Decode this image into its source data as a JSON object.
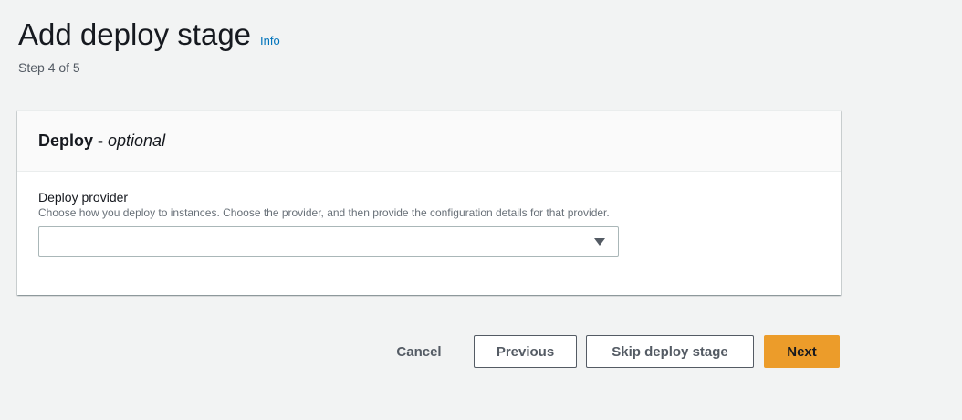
{
  "header": {
    "title": "Add deploy stage",
    "info_link": "Info",
    "step": "Step 4 of 5"
  },
  "panel": {
    "title_main": "Deploy - ",
    "title_optional": "optional",
    "field": {
      "label": "Deploy provider",
      "description": "Choose how you deploy to instances. Choose the provider, and then provide the configuration details for that provider.",
      "selected_value": ""
    }
  },
  "actions": {
    "cancel": "Cancel",
    "previous": "Previous",
    "skip": "Skip deploy stage",
    "next": "Next"
  },
  "colors": {
    "primary_button": "#ec9c2a",
    "link": "#0073bb",
    "background": "#f2f3f3"
  }
}
